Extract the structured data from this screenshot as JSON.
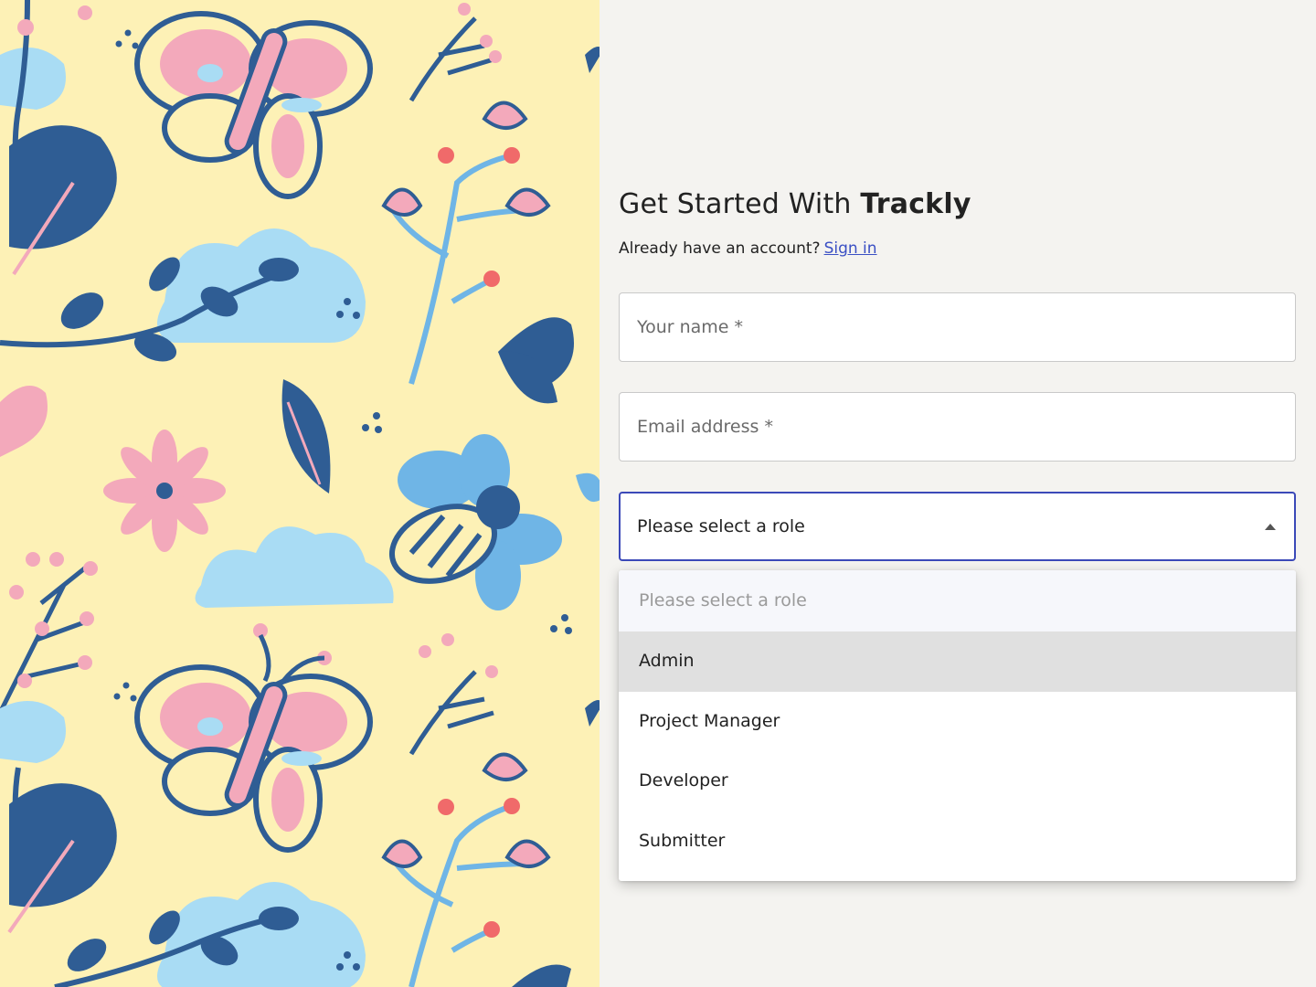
{
  "decor": {
    "palette": {
      "background": "#fdf1b6",
      "navy": "#2f5d94",
      "pink": "#f3a9bb",
      "sky": "#a9dcf4",
      "blue": "#6fb5e6",
      "coral": "#f06a6a"
    }
  },
  "heading": {
    "prefix": "Get Started With",
    "brand": "Trackly"
  },
  "signin": {
    "prompt": "Already have an account?",
    "link_label": "Sign in"
  },
  "form": {
    "name_placeholder": "Your name *",
    "email_placeholder": "Email address *",
    "role_select": {
      "value": "Please select a role",
      "state": "open"
    },
    "role_options": [
      {
        "label": "Please select a role",
        "kind": "placeholder"
      },
      {
        "label": "Admin",
        "kind": "highlighted"
      },
      {
        "label": "Project Manager",
        "kind": "normal"
      },
      {
        "label": "Developer",
        "kind": "normal"
      },
      {
        "label": "Submitter",
        "kind": "normal"
      }
    ],
    "colors": {
      "focus_border": "#3b49b8",
      "link": "#3a4fc4",
      "highlight_row": "#e0e0e0"
    }
  }
}
